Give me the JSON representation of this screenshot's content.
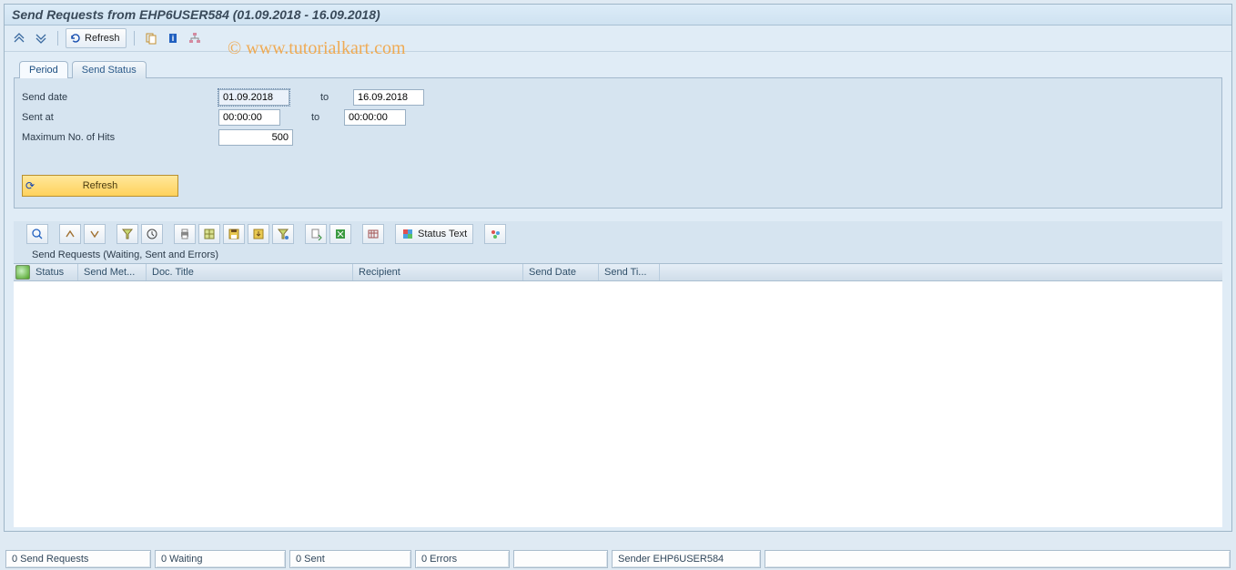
{
  "title": "Send Requests from EHP6USER584 (01.09.2018 - 16.09.2018)",
  "watermark": "©  www.tutorialkart.com",
  "toolbar": {
    "refresh_label": "Refresh"
  },
  "tabs": {
    "period": "Period",
    "send_status": "Send Status"
  },
  "form": {
    "send_date_label": "Send date",
    "send_date_from": "01.09.2018",
    "send_date_to_label": "to",
    "send_date_to": "16.09.2018",
    "sent_at_label": "Sent at",
    "sent_at_from": "00:00:00",
    "sent_at_to_label": "to",
    "sent_at_to": "00:00:00",
    "max_hits_label": "Maximum No. of Hits",
    "max_hits": "500",
    "refresh_button": "Refresh"
  },
  "alv": {
    "status_text_btn": "Status Text",
    "subtitle": "Send Requests (Waiting, Sent and Errors)",
    "columns": {
      "status": "Status",
      "send_method": "Send Met...",
      "doc_title": "Doc. Title",
      "recipient": "Recipient",
      "send_date": "Send Date",
      "send_time": "Send Ti..."
    }
  },
  "status": {
    "requests": "0 Send Requests",
    "waiting": "0 Waiting",
    "sent": "0 Sent",
    "errors": "0 Errors",
    "sender": "Sender EHP6USER584"
  }
}
